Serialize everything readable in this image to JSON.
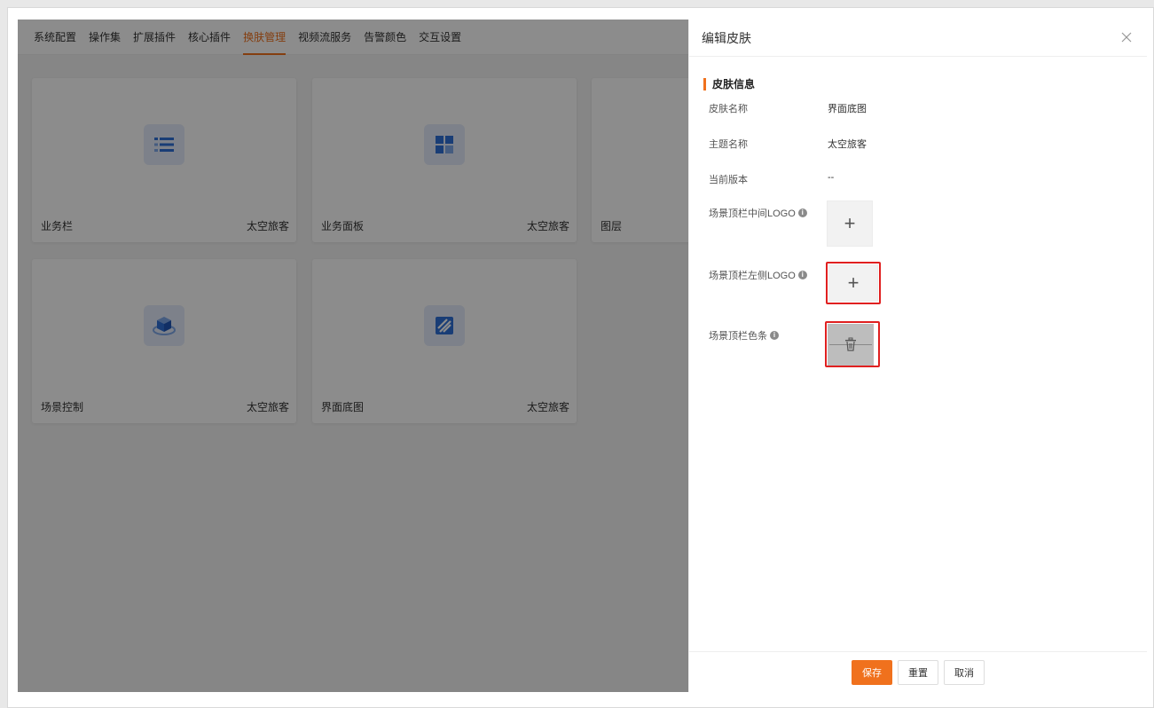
{
  "tabs": [
    {
      "label": "系统配置",
      "active": false
    },
    {
      "label": "操作集",
      "active": false
    },
    {
      "label": "扩展插件",
      "active": false
    },
    {
      "label": "核心插件",
      "active": false
    },
    {
      "label": "换肤管理",
      "active": true
    },
    {
      "label": "视频流服务",
      "active": false
    },
    {
      "label": "告警颜色",
      "active": false
    },
    {
      "label": "交互设置",
      "active": false
    }
  ],
  "cards": [
    {
      "name": "业务栏",
      "theme": "太空旅客",
      "icon": "list-icon"
    },
    {
      "name": "业务面板",
      "theme": "太空旅客",
      "icon": "grid-icon"
    },
    {
      "name": "图层",
      "theme": "",
      "icon": "layers-icon"
    },
    {
      "name": "场景控制",
      "theme": "太空旅客",
      "icon": "cube-icon"
    },
    {
      "name": "界面底图",
      "theme": "太空旅客",
      "icon": "image-icon"
    }
  ],
  "drawer": {
    "title": "编辑皮肤",
    "section_title": "皮肤信息",
    "fields": {
      "skin_name": {
        "label": "皮肤名称",
        "value": "界面底图"
      },
      "theme_name": {
        "label": "主题名称",
        "value": "太空旅客"
      },
      "version": {
        "label": "当前版本",
        "value": "--"
      },
      "logo_center": {
        "label": "场景顶栏中间LOGO"
      },
      "logo_left": {
        "label": "场景顶栏左侧LOGO"
      },
      "color_bar": {
        "label": "场景顶栏色条"
      }
    },
    "buttons": {
      "save": "保存",
      "reset": "重置",
      "cancel": "取消"
    }
  },
  "colors": {
    "accent": "#f0711d",
    "highlight": "#e02020",
    "icon_blue": "#2f6fd8"
  }
}
